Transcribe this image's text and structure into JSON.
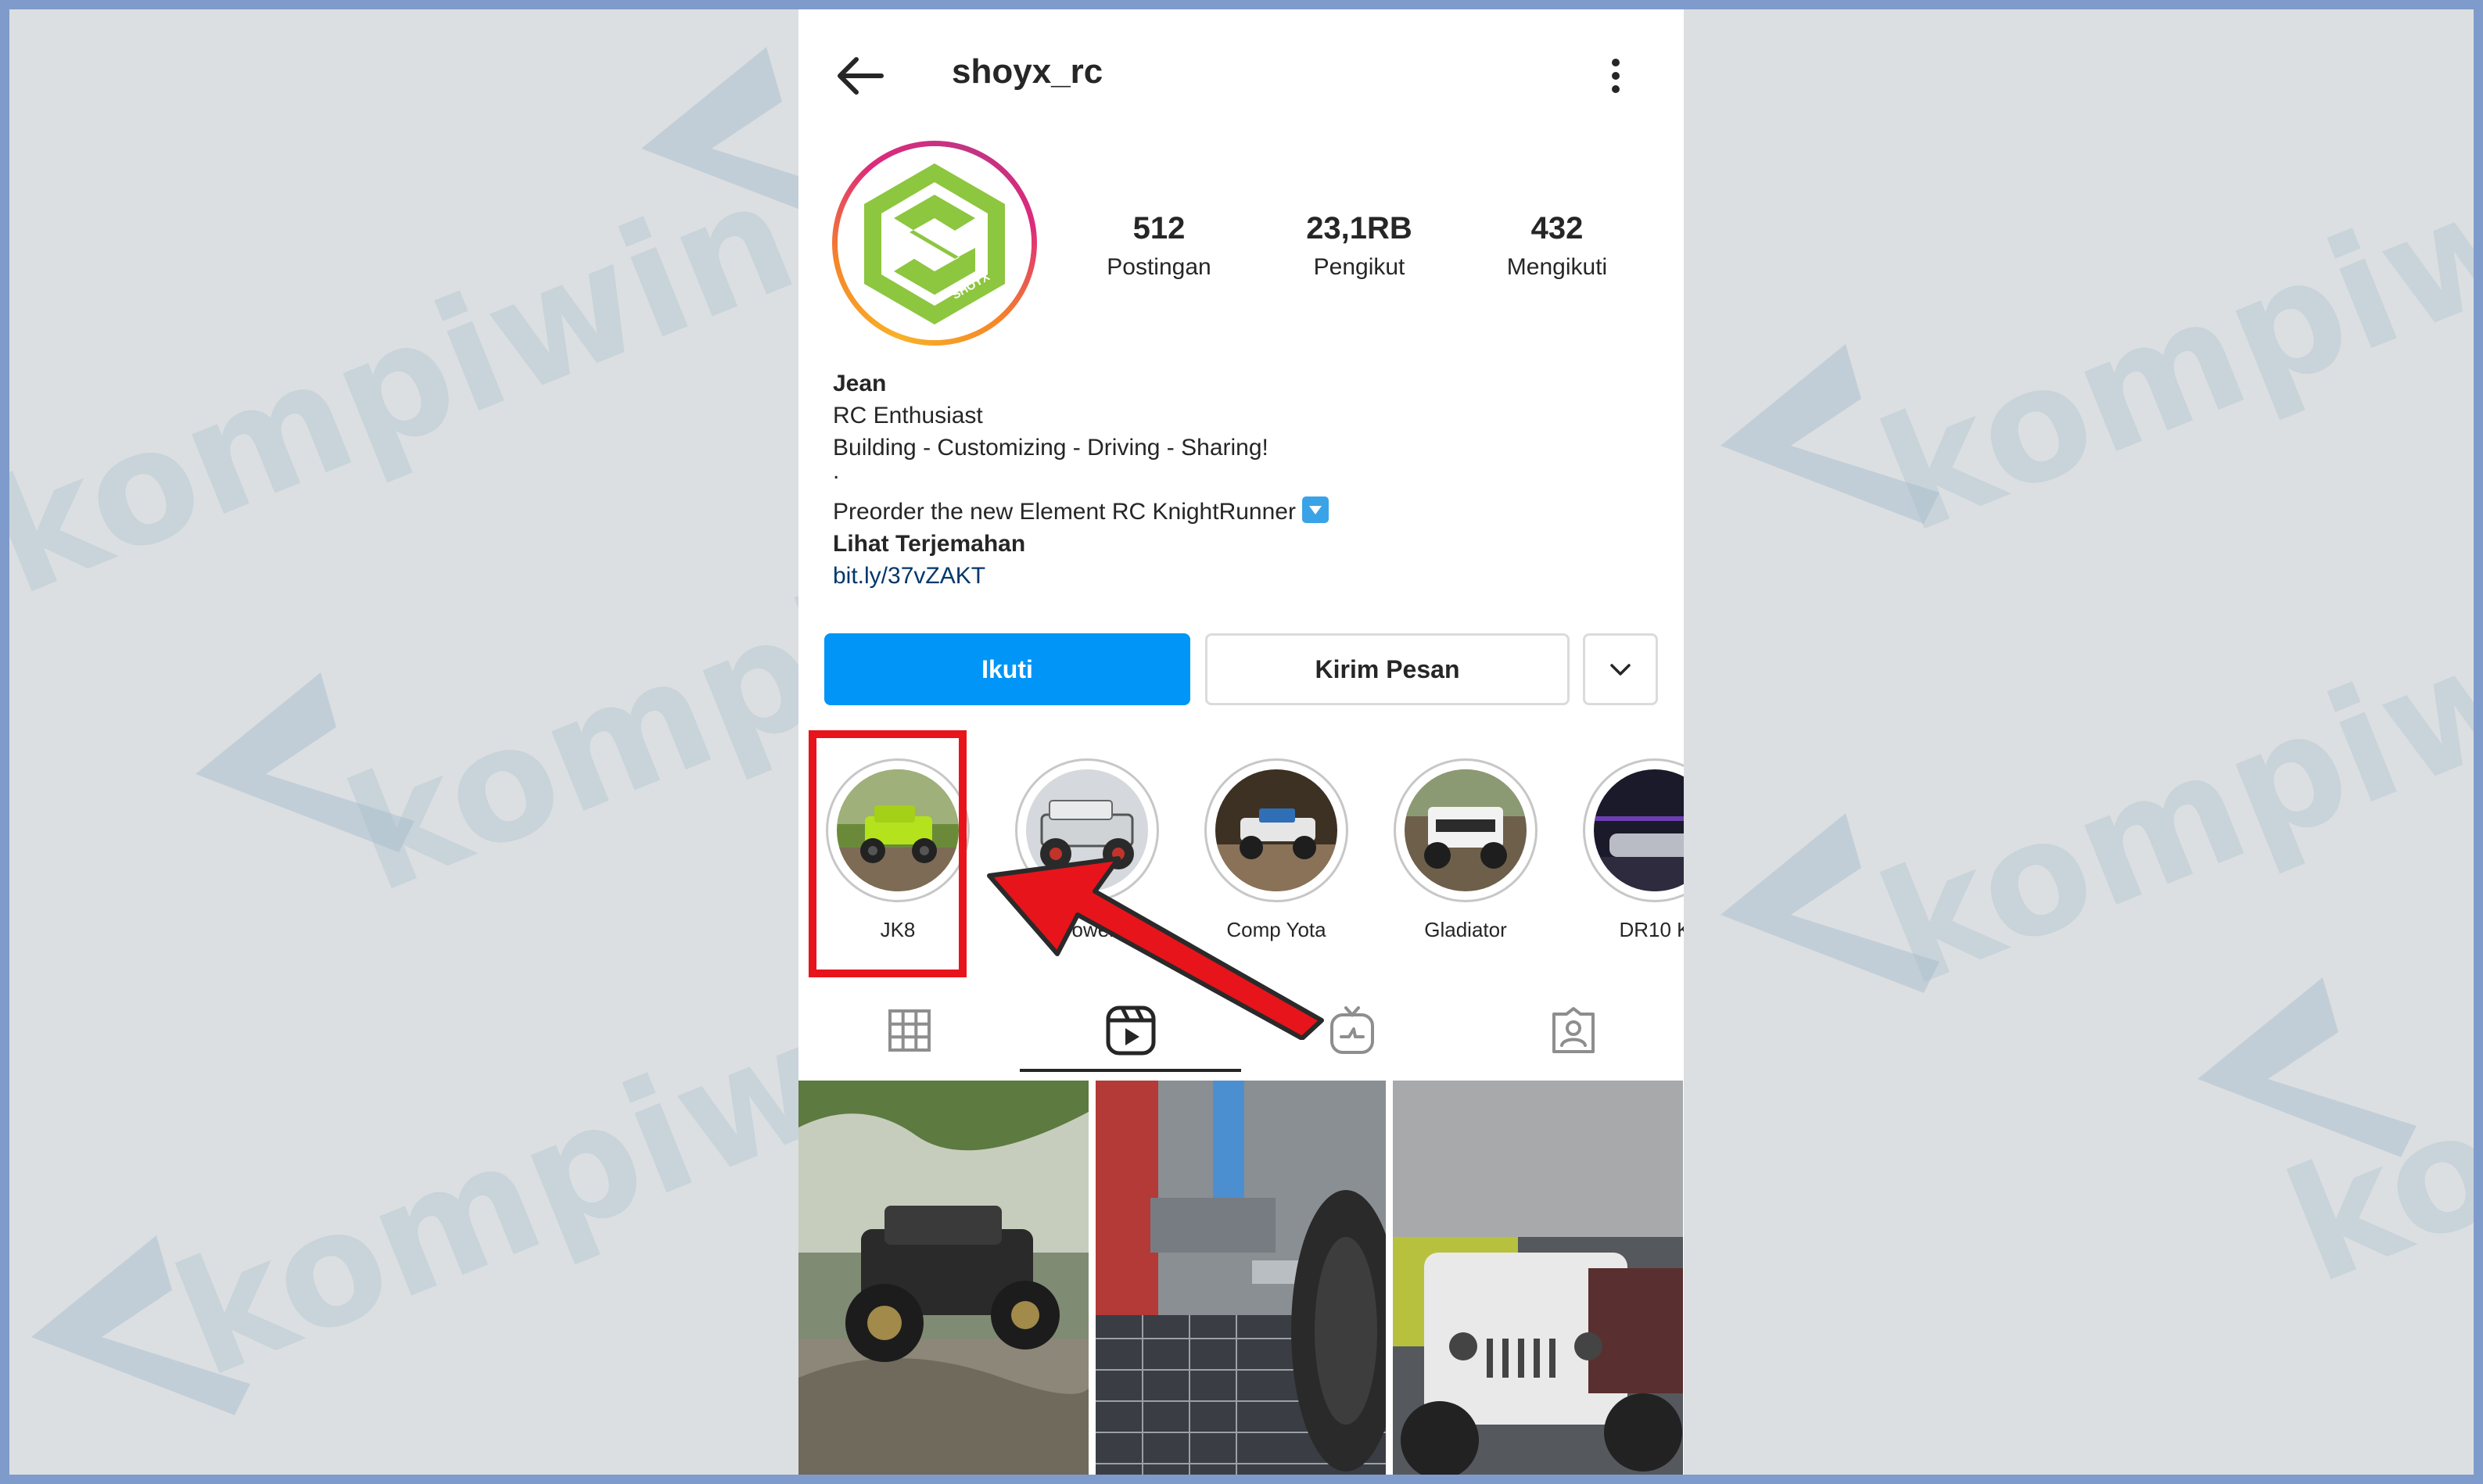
{
  "header": {
    "username": "shoyx_rc"
  },
  "stats": [
    {
      "value": "512",
      "label": "Postingan"
    },
    {
      "value": "23,1RB",
      "label": "Pengikut"
    },
    {
      "value": "432",
      "label": "Mengikuti"
    }
  ],
  "bio": {
    "name": "Jean",
    "line1": "RC Enthusiast",
    "line2": "Building - Customizing - Driving - Sharing!",
    "line3": ".",
    "line4": "Preorder the new Element RC KnightRunner",
    "translate": "Lihat Terjemahan",
    "link": "bit.ly/37vZAKT"
  },
  "actions": {
    "follow": "Ikuti",
    "message": "Kirim Pesan"
  },
  "highlights": [
    {
      "label": "JK8"
    },
    {
      "label": "Power"
    },
    {
      "label": "Comp Yota"
    },
    {
      "label": "Gladiator"
    },
    {
      "label": "DR10 K"
    }
  ],
  "avatar": {
    "text": "SHOYX"
  },
  "watermark": {
    "text": "kompiwin"
  },
  "colors": {
    "accent": "#0095f6",
    "annotation": "#e8141b",
    "frame": "#7f9bcb"
  }
}
